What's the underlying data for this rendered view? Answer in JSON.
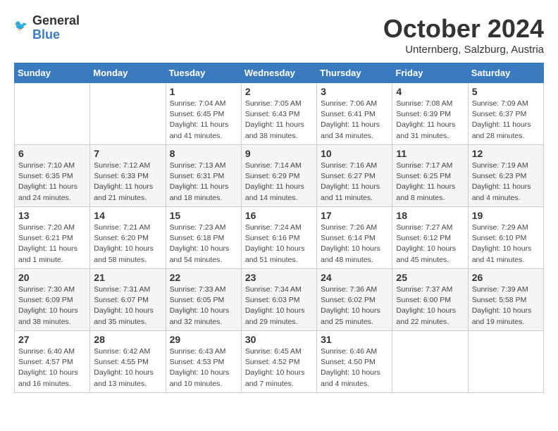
{
  "header": {
    "logo_general": "General",
    "logo_blue": "Blue",
    "month": "October 2024",
    "location": "Unternberg, Salzburg, Austria"
  },
  "weekdays": [
    "Sunday",
    "Monday",
    "Tuesday",
    "Wednesday",
    "Thursday",
    "Friday",
    "Saturday"
  ],
  "weeks": [
    [
      {
        "day": "",
        "info": ""
      },
      {
        "day": "",
        "info": ""
      },
      {
        "day": "1",
        "info": "Sunrise: 7:04 AM\nSunset: 6:45 PM\nDaylight: 11 hours and 41 minutes."
      },
      {
        "day": "2",
        "info": "Sunrise: 7:05 AM\nSunset: 6:43 PM\nDaylight: 11 hours and 38 minutes."
      },
      {
        "day": "3",
        "info": "Sunrise: 7:06 AM\nSunset: 6:41 PM\nDaylight: 11 hours and 34 minutes."
      },
      {
        "day": "4",
        "info": "Sunrise: 7:08 AM\nSunset: 6:39 PM\nDaylight: 11 hours and 31 minutes."
      },
      {
        "day": "5",
        "info": "Sunrise: 7:09 AM\nSunset: 6:37 PM\nDaylight: 11 hours and 28 minutes."
      }
    ],
    [
      {
        "day": "6",
        "info": "Sunrise: 7:10 AM\nSunset: 6:35 PM\nDaylight: 11 hours and 24 minutes."
      },
      {
        "day": "7",
        "info": "Sunrise: 7:12 AM\nSunset: 6:33 PM\nDaylight: 11 hours and 21 minutes."
      },
      {
        "day": "8",
        "info": "Sunrise: 7:13 AM\nSunset: 6:31 PM\nDaylight: 11 hours and 18 minutes."
      },
      {
        "day": "9",
        "info": "Sunrise: 7:14 AM\nSunset: 6:29 PM\nDaylight: 11 hours and 14 minutes."
      },
      {
        "day": "10",
        "info": "Sunrise: 7:16 AM\nSunset: 6:27 PM\nDaylight: 11 hours and 11 minutes."
      },
      {
        "day": "11",
        "info": "Sunrise: 7:17 AM\nSunset: 6:25 PM\nDaylight: 11 hours and 8 minutes."
      },
      {
        "day": "12",
        "info": "Sunrise: 7:19 AM\nSunset: 6:23 PM\nDaylight: 11 hours and 4 minutes."
      }
    ],
    [
      {
        "day": "13",
        "info": "Sunrise: 7:20 AM\nSunset: 6:21 PM\nDaylight: 11 hours and 1 minute."
      },
      {
        "day": "14",
        "info": "Sunrise: 7:21 AM\nSunset: 6:20 PM\nDaylight: 10 hours and 58 minutes."
      },
      {
        "day": "15",
        "info": "Sunrise: 7:23 AM\nSunset: 6:18 PM\nDaylight: 10 hours and 54 minutes."
      },
      {
        "day": "16",
        "info": "Sunrise: 7:24 AM\nSunset: 6:16 PM\nDaylight: 10 hours and 51 minutes."
      },
      {
        "day": "17",
        "info": "Sunrise: 7:26 AM\nSunset: 6:14 PM\nDaylight: 10 hours and 48 minutes."
      },
      {
        "day": "18",
        "info": "Sunrise: 7:27 AM\nSunset: 6:12 PM\nDaylight: 10 hours and 45 minutes."
      },
      {
        "day": "19",
        "info": "Sunrise: 7:29 AM\nSunset: 6:10 PM\nDaylight: 10 hours and 41 minutes."
      }
    ],
    [
      {
        "day": "20",
        "info": "Sunrise: 7:30 AM\nSunset: 6:09 PM\nDaylight: 10 hours and 38 minutes."
      },
      {
        "day": "21",
        "info": "Sunrise: 7:31 AM\nSunset: 6:07 PM\nDaylight: 10 hours and 35 minutes."
      },
      {
        "day": "22",
        "info": "Sunrise: 7:33 AM\nSunset: 6:05 PM\nDaylight: 10 hours and 32 minutes."
      },
      {
        "day": "23",
        "info": "Sunrise: 7:34 AM\nSunset: 6:03 PM\nDaylight: 10 hours and 29 minutes."
      },
      {
        "day": "24",
        "info": "Sunrise: 7:36 AM\nSunset: 6:02 PM\nDaylight: 10 hours and 25 minutes."
      },
      {
        "day": "25",
        "info": "Sunrise: 7:37 AM\nSunset: 6:00 PM\nDaylight: 10 hours and 22 minutes."
      },
      {
        "day": "26",
        "info": "Sunrise: 7:39 AM\nSunset: 5:58 PM\nDaylight: 10 hours and 19 minutes."
      }
    ],
    [
      {
        "day": "27",
        "info": "Sunrise: 6:40 AM\nSunset: 4:57 PM\nDaylight: 10 hours and 16 minutes."
      },
      {
        "day": "28",
        "info": "Sunrise: 6:42 AM\nSunset: 4:55 PM\nDaylight: 10 hours and 13 minutes."
      },
      {
        "day": "29",
        "info": "Sunrise: 6:43 AM\nSunset: 4:53 PM\nDaylight: 10 hours and 10 minutes."
      },
      {
        "day": "30",
        "info": "Sunrise: 6:45 AM\nSunset: 4:52 PM\nDaylight: 10 hours and 7 minutes."
      },
      {
        "day": "31",
        "info": "Sunrise: 6:46 AM\nSunset: 4:50 PM\nDaylight: 10 hours and 4 minutes."
      },
      {
        "day": "",
        "info": ""
      },
      {
        "day": "",
        "info": ""
      }
    ]
  ]
}
